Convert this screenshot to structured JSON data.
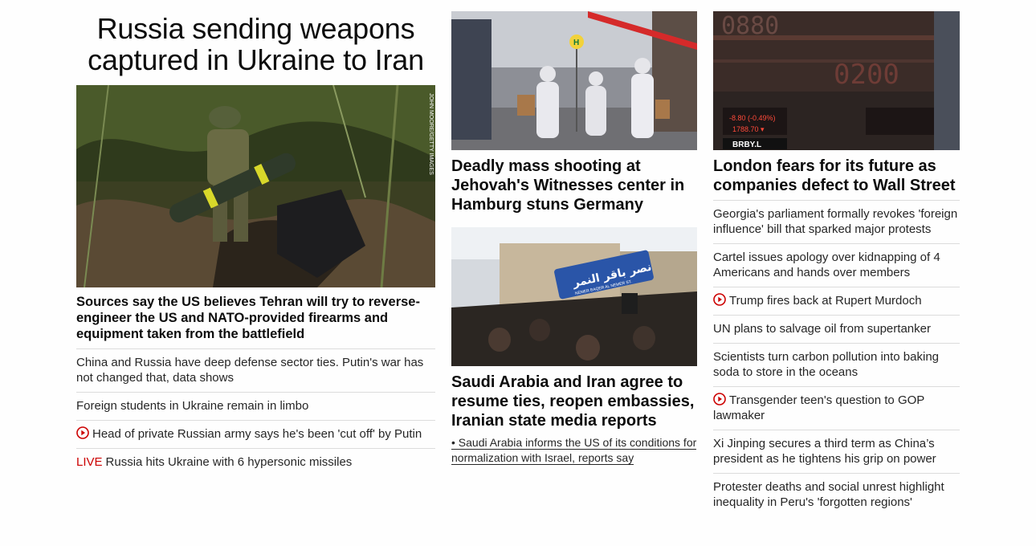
{
  "col1": {
    "headline": "Russia sending weapons captured in Ukraine to Iran",
    "hero_credit": "JOHN MOORE/GETTY IMAGES",
    "hero_caption": "Sources say the US believes Tehran will try to reverse-engineer the US and NATO-provided firearms and equipment taken from the battlefield",
    "items": [
      {
        "text": "China and Russia have deep defense sector ties. Putin's war has not changed that, data shows"
      },
      {
        "text": "Foreign students in Ukraine remain in limbo"
      },
      {
        "text": "Head of private Russian army says he's been 'cut off' by Putin"
      },
      {
        "label": "LIVE",
        "text": "Russia hits Ukraine with 6 hypersonic missiles"
      }
    ]
  },
  "col2": {
    "story1": {
      "title": "Deadly mass shooting at Jehovah's Witnesses center in Hamburg stuns Germany"
    },
    "story2": {
      "sign_text": "نصر باقر النمر",
      "sign_sub": "NEMER BAQER AL NEMER ST.",
      "title": "Saudi Arabia and Iran agree to resume ties, reopen embassies, Iranian state media reports",
      "subnote": "• Saudi Arabia informs the US of its conditions for normalization with Israel, reports say"
    }
  },
  "col3": {
    "story": {
      "title": "London fears for its future as companies defect to Wall Street",
      "ticker1": "-8.80 (-0.49%)",
      "ticker1b": "1788.70 ▾",
      "ticker_sym": "BRBY.L"
    },
    "items": [
      {
        "text": "Georgia's parliament formally revokes 'foreign influence' bill that sparked major protests"
      },
      {
        "text": "Cartel issues apology over kidnapping of 4 Americans and hands over members"
      },
      {
        "text": "Trump fires back at Rupert Murdoch"
      },
      {
        "text": "UN plans to salvage oil from supertanker"
      },
      {
        "text": "Scientists turn carbon pollution into baking soda to store in the oceans"
      },
      {
        "text": "Transgender teen's question to GOP lawmaker"
      },
      {
        "text": "Xi Jinping secures a third term as China’s president as he tightens his grip on power"
      },
      {
        "text": "Protester deaths and social unrest highlight inequality in Peru's 'forgotten regions'"
      }
    ]
  },
  "colors": {
    "live": "#cc0000",
    "play": "#cc0000",
    "divider": "#dcdcdc"
  }
}
